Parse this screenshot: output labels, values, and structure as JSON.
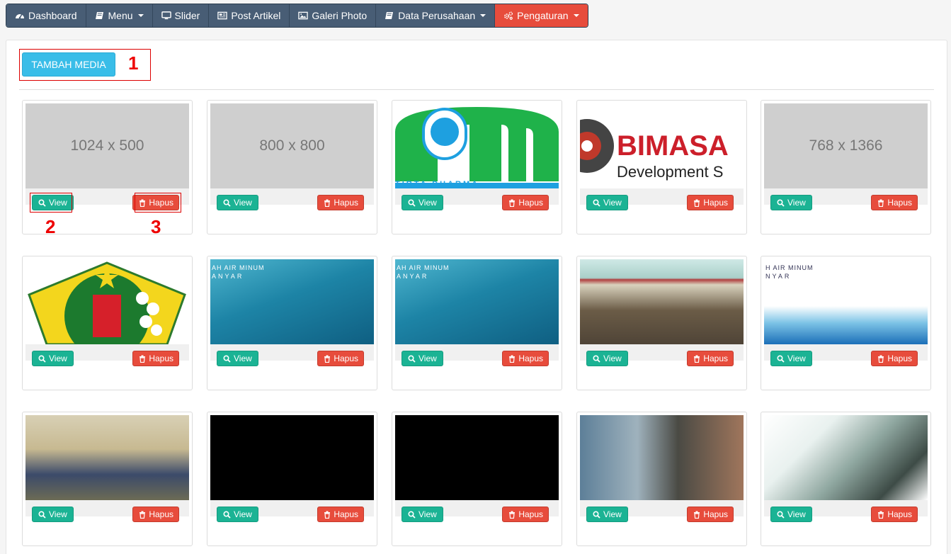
{
  "nav": {
    "items": [
      {
        "label": "Dashboard",
        "icon": "dashboard-icon",
        "dropdown": false,
        "active": false
      },
      {
        "label": "Menu",
        "icon": "book-icon",
        "dropdown": true,
        "active": false
      },
      {
        "label": "Slider",
        "icon": "desktop-icon",
        "dropdown": false,
        "active": false
      },
      {
        "label": "Post Artikel",
        "icon": "newspaper-icon",
        "dropdown": false,
        "active": false
      },
      {
        "label": "Galeri Photo",
        "icon": "image-icon",
        "dropdown": false,
        "active": false
      },
      {
        "label": "Data Perusahaan",
        "icon": "book-icon",
        "dropdown": true,
        "active": false
      },
      {
        "label": "Pengaturan",
        "icon": "cogs-icon",
        "dropdown": true,
        "active": true
      }
    ]
  },
  "toolbar": {
    "add_media_label": "TAMBAH MEDIA"
  },
  "annotations": {
    "one": "1",
    "two": "2",
    "three": "3"
  },
  "card_buttons": {
    "view_label": "View",
    "delete_label": "Hapus"
  },
  "media": [
    {
      "caption": "1024 x 500"
    },
    {
      "caption": "800 x 800"
    },
    {
      "caption": "TIRTA DHARMA"
    },
    {
      "caption": "BIMASA",
      "subcaption": "Development S"
    },
    {
      "caption": "768 x 1366"
    },
    {
      "caption": ""
    },
    {
      "caption": "AH AIR MINUM",
      "subcaption": "ANYAR"
    },
    {
      "caption": "AH AIR MINUM",
      "subcaption": "ANYAR"
    },
    {
      "caption": ""
    },
    {
      "caption": "H AIR MINUM",
      "subcaption": "NYAR"
    },
    {
      "caption": ""
    },
    {
      "caption": ""
    },
    {
      "caption": ""
    },
    {
      "caption": ""
    },
    {
      "caption": ""
    }
  ],
  "colors": {
    "navbar": "#485d75",
    "active_nav": "#e74c3c",
    "add_button": "#39bde8",
    "view_button": "#1bb394",
    "delete_button": "#e74c3c"
  }
}
